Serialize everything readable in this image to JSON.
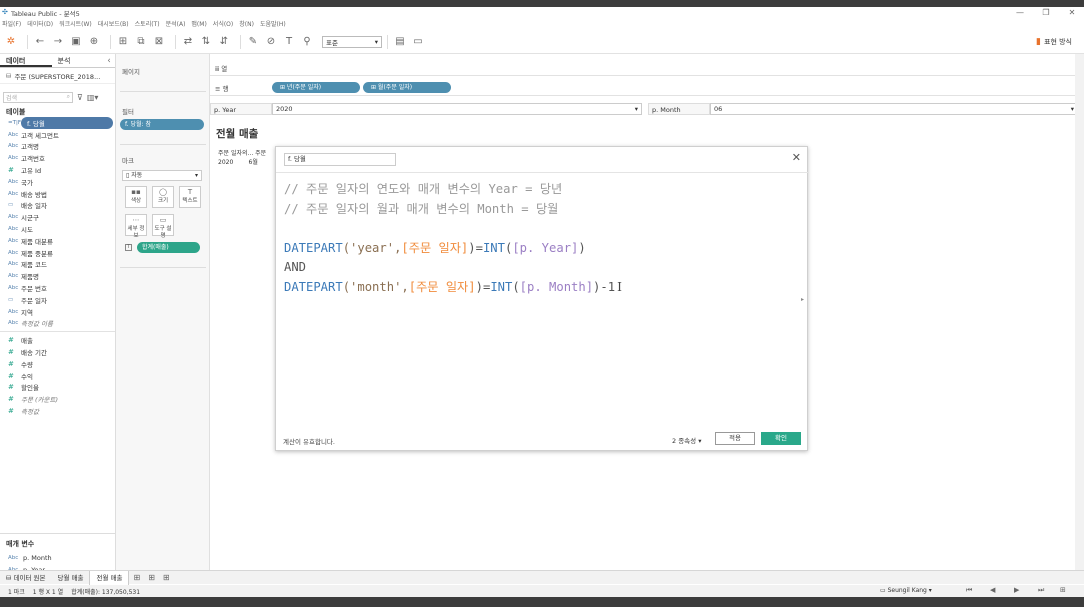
{
  "window": {
    "title": "Tableau Public - 분석5",
    "controls": [
      "—",
      "❐",
      "✕"
    ]
  },
  "menu": [
    "파일(F)",
    "데이터(D)",
    "워크시트(W)",
    "대시보드(B)",
    "스토리(T)",
    "분석(A)",
    "맵(M)",
    "서식(O)",
    "창(N)",
    "도움말(H)"
  ],
  "toolbar": {
    "fit_select": "표준",
    "show_me": "표현 방식"
  },
  "data_pane": {
    "tabs": [
      "데이터",
      "분석"
    ],
    "datasource": "주문 (SUPERSTORE_2018...",
    "search_placeholder": "검색",
    "tables_header": "테이블",
    "dimensions": [
      {
        "type": "=T|F",
        "label": "f. 당월",
        "selected": true
      },
      {
        "type": "Abc",
        "label": "고객 세그먼트"
      },
      {
        "type": "Abc",
        "label": "고객명"
      },
      {
        "type": "Abc",
        "label": "고객번호"
      },
      {
        "type": "#",
        "label": "고유 Id"
      },
      {
        "type": "Abc",
        "label": "국가"
      },
      {
        "type": "Abc",
        "label": "배송 방법"
      },
      {
        "type": "▭",
        "label": "배송 일자"
      },
      {
        "type": "Abc",
        "label": "시군구"
      },
      {
        "type": "Abc",
        "label": "시도"
      },
      {
        "type": "Abc",
        "label": "제품 대분류"
      },
      {
        "type": "Abc",
        "label": "제품 중분류"
      },
      {
        "type": "Abc",
        "label": "제품 코드"
      },
      {
        "type": "Abc",
        "label": "제품명"
      },
      {
        "type": "Abc",
        "label": "주문 번호"
      },
      {
        "type": "▭",
        "label": "주문 일자"
      },
      {
        "type": "Abc",
        "label": "지역"
      },
      {
        "type": "Abc",
        "label": "측정값 이름",
        "italic": true
      }
    ],
    "measures": [
      {
        "type": "#",
        "label": "매출"
      },
      {
        "type": "#",
        "label": "배송 기간"
      },
      {
        "type": "#",
        "label": "수량"
      },
      {
        "type": "#",
        "label": "수익"
      },
      {
        "type": "#",
        "label": "할인율"
      },
      {
        "type": "#",
        "label": "주문 (카운트)",
        "italic": true
      },
      {
        "type": "#",
        "label": "측정값",
        "italic": true
      }
    ],
    "params_header": "매개 변수",
    "params": [
      {
        "type": "Abc",
        "label": "p. Month"
      },
      {
        "type": "Abc",
        "label": "p. Year"
      }
    ]
  },
  "cards": {
    "pages": "페이지",
    "filters": "필터",
    "filter_pill": "f. 당월: 참",
    "marks": "마크",
    "marks_type": "자동",
    "mark_buttons": [
      {
        "icon": "▪▪",
        "label": "색상"
      },
      {
        "icon": "◯",
        "label": "크기"
      },
      {
        "icon": "T",
        "label": "텍스트"
      },
      {
        "icon": "⋯",
        "label": "세부 정보"
      },
      {
        "icon": "▭",
        "label": "도구 설명"
      }
    ],
    "marks_pill": "합계(매출)"
  },
  "shelves": {
    "columns_label": "열",
    "rows_label": "행",
    "rows_pills": [
      "⊞ 년(주문 일자)",
      "⊞ 월(주문 일자)"
    ]
  },
  "parameters_row": {
    "year_label": "p. Year",
    "year_value": "2020",
    "month_label": "p. Month",
    "month_value": "06"
  },
  "view": {
    "title": "전월 매출",
    "col_head_1": "주문 일자의...",
    "col_head_2": "주문",
    "row_val_1": "2020",
    "row_val_2": "6월"
  },
  "calc_dialog": {
    "name": "f. 당월",
    "comment1": "// 주문 일자의 연도와 매개 변수의 Year = 당년",
    "comment2": "// 주문 일자의 월과 매개 변수의 Month = 당월",
    "fn1": "DATEPART",
    "str_year": "('year',",
    "field_order_date": "[주문 일자]",
    "close_paren_eq": ")=",
    "fn_int": "INT",
    "open_paren": "(",
    "param_year": "[p. Year]",
    "close_paren": ")",
    "and": "AND",
    "str_month": "('month',",
    "param_month": "[p. Month]",
    "minus_one": ")-1",
    "status": "계산이 유효합니다.",
    "dependencies": "2 종속성 ▾",
    "apply": "적용",
    "ok": "확인"
  },
  "sheet_tabs": {
    "data_source": "데이터 원본",
    "tabs": [
      "당월 매출",
      "전월 매출"
    ]
  },
  "status_bar": {
    "marks": "1 마크",
    "rows_cols": "1 행 X 1 열",
    "sum": "합계(매출): 137,050,531",
    "user": "Seungil Kang"
  },
  "colors": {
    "pill_blue": "#4e8fb0",
    "pill_green": "#2da58a",
    "fn_blue": "#3c7ab8",
    "field_orange": "#f08c3c",
    "param_purple": "#9b7fc4"
  }
}
